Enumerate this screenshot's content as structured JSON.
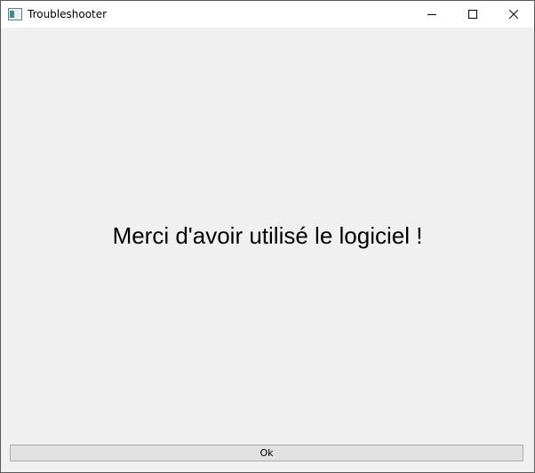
{
  "window": {
    "title": "Troubleshooter",
    "icon": "app-window-icon",
    "controls": [
      "minimize-icon",
      "maximize-icon",
      "close-icon"
    ]
  },
  "main": {
    "message": "Merci d'avoir utilisé le logiciel !"
  },
  "footer": {
    "ok_label": "Ok"
  }
}
